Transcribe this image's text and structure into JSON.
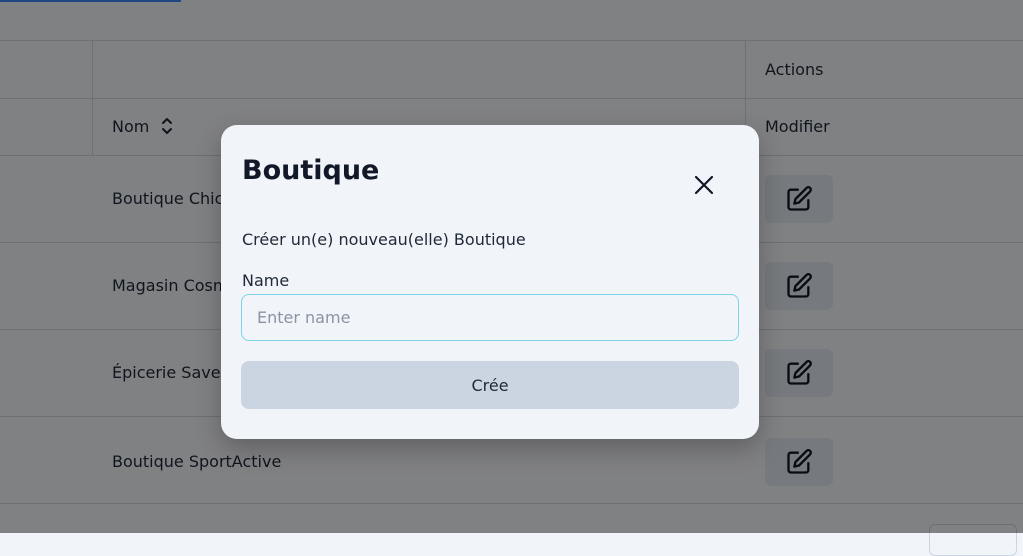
{
  "table": {
    "header_group": {
      "actions_label": "Actions"
    },
    "columns": {
      "name_label": "Nom",
      "edit_label": "Modifier"
    },
    "rows": [
      {
        "name": "Boutique ChicMode"
      },
      {
        "name": "Magasin CosmoBeauté"
      },
      {
        "name": "Épicerie Saveurs"
      },
      {
        "name": "Boutique SportActive"
      }
    ]
  },
  "modal": {
    "title": "Boutique",
    "description": "Créer un(e) nouveau(elle) Boutique",
    "field_label": "Name",
    "input_placeholder": "Enter name",
    "input_value": "",
    "submit_label": "Crée",
    "close_icon": "close-icon"
  },
  "colors": {
    "background": "#f1f4f8",
    "overlay": "rgba(0,0,0,0.47)",
    "input_border": "#7dd3e8",
    "button_bg": "#cbd5e1",
    "accent": "#3b82f6"
  }
}
